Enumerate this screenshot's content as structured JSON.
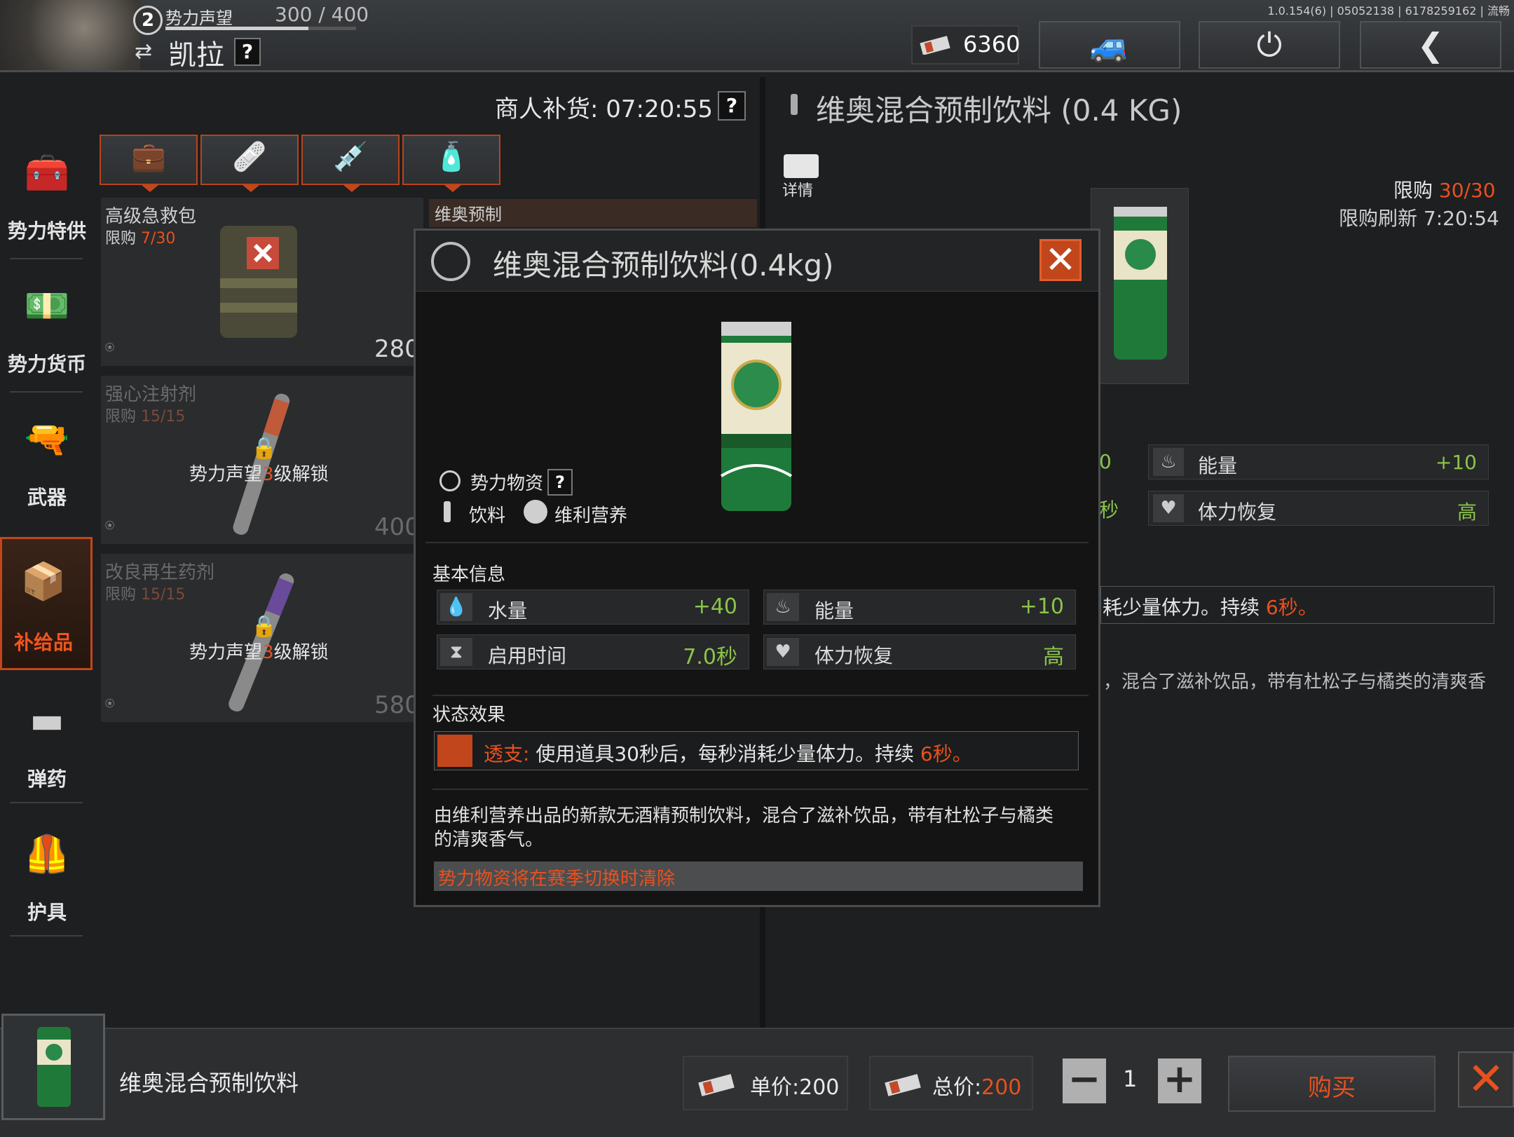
{
  "header": {
    "rank": "2",
    "reputation_label": "势力声望",
    "reputation_value": "300 / 400",
    "reputation_progress": 0.75,
    "faction_name": "凯拉",
    "help": "?",
    "version": "1.0.154(6) | 05052138 | 6178259162 | 流畅",
    "money": "6360"
  },
  "nav": {
    "items": [
      {
        "label": "势力特供",
        "icon": "toolbox-icon"
      },
      {
        "label": "势力货币",
        "icon": "cash-icon"
      },
      {
        "label": "武器",
        "icon": "rifle-icon"
      },
      {
        "label": "补给品",
        "icon": "supply-box-icon",
        "active": true
      },
      {
        "label": "弹药",
        "icon": "bullet-icon"
      },
      {
        "label": "护具",
        "icon": "vest-icon"
      }
    ]
  },
  "shop": {
    "restock_label": "商人补货: 07:20:55",
    "restock_help": "?",
    "cards": [
      {
        "name": "高级急救包",
        "limit_label": "限购",
        "limit_value": "7/30",
        "price": "280"
      },
      {
        "name": "强心注射剂",
        "limit_label": "限购",
        "limit_value": "15/15",
        "price": "400",
        "lock_prefix": "势力声望",
        "lock_level": "3",
        "lock_suffix": "级解锁"
      },
      {
        "name": "改良再生药剂",
        "limit_label": "限购",
        "limit_value": "15/15",
        "price": "580",
        "lock_prefix": "势力声望",
        "lock_level": "3",
        "lock_suffix": "级解锁"
      },
      {
        "name": "维奥预制"
      }
    ]
  },
  "detail_panel": {
    "title": "维奥混合预制饮料 (0.4 KG)",
    "details_label": "详情",
    "limit_label": "限购",
    "limit_value": "30/30",
    "refresh": "限购刷新 7:20:54",
    "stat_frag_1": "0",
    "stat_frag_2": "秒",
    "energy_label": "能量",
    "energy_value": "+10",
    "stamina_label": "体力恢复",
    "stamina_value": "高",
    "effect_frag_prefix": "耗少量体力。持续 ",
    "effect_frag_dur": "6秒。",
    "desc_frag": "，混合了滋补饮品，带有杜松子与橘类的清爽香"
  },
  "modal": {
    "title": "维奥混合预制饮料(0.4kg)",
    "tag_faction": "势力物资",
    "tag_help": "?",
    "tag_drink": "饮料",
    "tag_brand": "维利营养",
    "basic_info_label": "基本信息",
    "stats": [
      {
        "label": "水量",
        "value": "+40",
        "icon": "water-drop-icon"
      },
      {
        "label": "能量",
        "value": "+10",
        "icon": "stomach-icon"
      },
      {
        "label": "启用时间",
        "value": "7.0秒",
        "icon": "hourglass-icon"
      },
      {
        "label": "体力恢复",
        "value": "高",
        "icon": "heart-bolt-icon"
      }
    ],
    "status_label": "状态效果",
    "effect_name": "透支:",
    "effect_text": " 使用道具30秒后，每秒消耗少量体力。持续 ",
    "effect_duration": "6秒。",
    "description": "由维利营养出品的新款无酒精预制饮料，混合了滋补饮品，带有杜松子与橘类的清爽香气。",
    "warning": "势力物资将在赛季切换时清除"
  },
  "bottom": {
    "item_name": "维奥混合预制饮料",
    "unit_price_label": "单价:",
    "unit_price": "200",
    "total_price_label": "总价:",
    "total_price": "200",
    "quantity": "1",
    "buy_label": "购买"
  },
  "colors": {
    "accent": "#e8511e",
    "positive": "#8bc34a"
  }
}
